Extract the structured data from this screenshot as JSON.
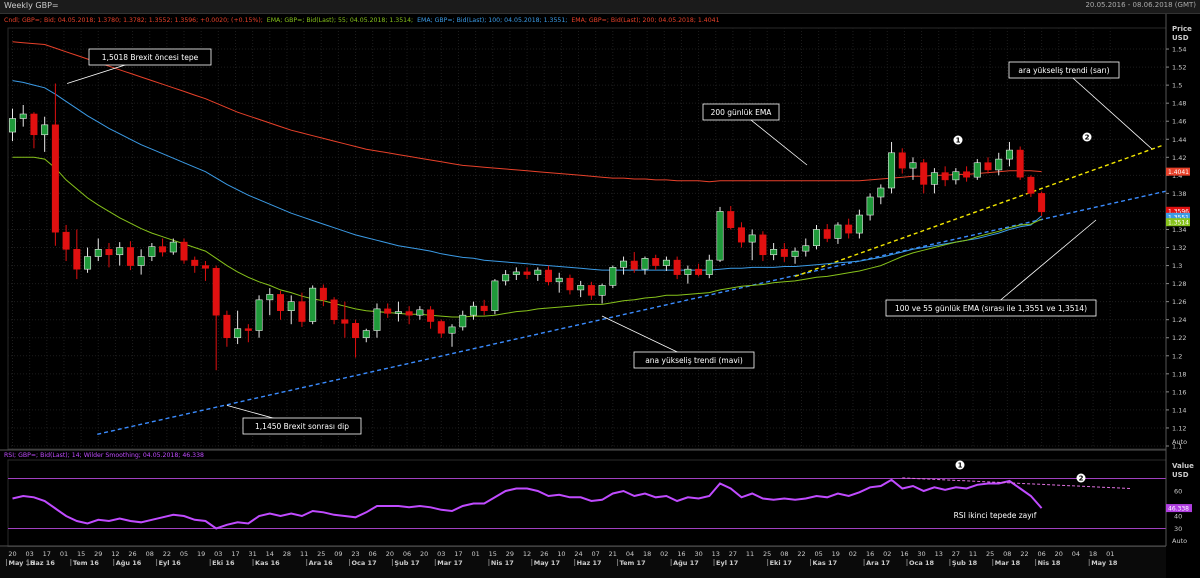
{
  "window": {
    "title": "Weekly GBP=",
    "date_range": "20.05.2016 - 08.06.2018 (GMT)"
  },
  "legend": {
    "ohlc": "Cndl; GBP=; Bid; 04.05.2018; 1.3780; 1.3782; 1.3552; 1.3596; +0.0020; (+0.15%);",
    "ema55": "EMA; GBP=; Bid(Last); 55; 04.05.2018; 1.3514;",
    "ema100": "EMA; GBP=; Bid(Last); 100; 04.05.2018; 1.3551;",
    "ema200": "EMA; GBP=; Bid(Last); 200; 04.05.2018; 1.4041",
    "rsi": "RSI; GBP=; Bid(Last); 14; Wilder Smoothing; 04.05.2018; 46.338"
  },
  "axis": {
    "price_title": "Price",
    "price_unit": "USD",
    "value_title": "Value",
    "value_unit": "USD",
    "auto_label": "Auto",
    "price_ticks": [
      "1.54",
      "1.52",
      "1.5",
      "1.48",
      "1.46",
      "1.44",
      "1.42",
      "1.4",
      "1.38",
      "1.36",
      "1.34",
      "1.32",
      "1.3",
      "1.28",
      "1.26",
      "1.24",
      "1.22",
      "1.2",
      "1.18",
      "1.16",
      "1.14",
      "1.12",
      "1.1"
    ],
    "rsi_ticks": [
      "60",
      "40",
      "30"
    ],
    "price_badges": [
      {
        "label": "1.4041",
        "value": 1.4041,
        "color": "#e8412a"
      },
      {
        "label": "1.3596",
        "value": 1.3596,
        "color": "#e01010"
      },
      {
        "label": "1.3551",
        "value": 1.3551,
        "color": "#3b9be6"
      },
      {
        "label": "1.3514",
        "value": 1.3514,
        "color": "#86c21b"
      }
    ],
    "rsi_badge": {
      "label": "46.338",
      "value": 46.338,
      "color": "#b03ee0"
    },
    "x_days": [
      "20",
      "03",
      "17",
      "01",
      "15",
      "29",
      "12",
      "26",
      "08",
      "22",
      "05",
      "19",
      "03",
      "17",
      "31",
      "14",
      "28",
      "11",
      "25",
      "09",
      "23",
      "06",
      "20",
      "06",
      "20",
      "03",
      "17",
      "01",
      "15",
      "29",
      "12",
      "26",
      "10",
      "24",
      "07",
      "21",
      "04",
      "18",
      "02",
      "16",
      "30",
      "13",
      "27",
      "11",
      "25",
      "08",
      "22",
      "05",
      "19",
      "02",
      "16",
      "02",
      "16",
      "30",
      "13",
      "27",
      "11",
      "25",
      "08",
      "22",
      "06",
      "20",
      "04",
      "18",
      "01"
    ],
    "x_months": [
      {
        "label": "May 16",
        "i": 0
      },
      {
        "label": "Haz 16",
        "i": 2
      },
      {
        "label": "Tem 16",
        "i": 6
      },
      {
        "label": "Ağu 16",
        "i": 10
      },
      {
        "label": "Eyl 16",
        "i": 14
      },
      {
        "label": "Eki 16",
        "i": 19
      },
      {
        "label": "Kas 16",
        "i": 23
      },
      {
        "label": "Ara 16",
        "i": 28
      },
      {
        "label": "Oca 17",
        "i": 32
      },
      {
        "label": "Şub 17",
        "i": 36
      },
      {
        "label": "Mar 17",
        "i": 40
      },
      {
        "label": "Nis 17",
        "i": 45
      },
      {
        "label": "May 17",
        "i": 49
      },
      {
        "label": "Haz 17",
        "i": 53
      },
      {
        "label": "Tem 17",
        "i": 57
      },
      {
        "label": "Ağu 17",
        "i": 62
      },
      {
        "label": "Eyl 17",
        "i": 66
      },
      {
        "label": "Eki 17",
        "i": 71
      },
      {
        "label": "Kas 17",
        "i": 75
      },
      {
        "label": "Ara 17",
        "i": 80
      },
      {
        "label": "Oca 18",
        "i": 84
      },
      {
        "label": "Şub 18",
        "i": 88
      },
      {
        "label": "Mar 18",
        "i": 92
      },
      {
        "label": "Nis 18",
        "i": 96
      },
      {
        "label": "May 18",
        "i": 101
      }
    ]
  },
  "annotations": {
    "brexit_top": "1,5018 Brexit öncesi tepe",
    "brexit_dip": "1,1450 Brexit sonrası dip",
    "ema200_note": "200 günlük EMA",
    "yellow_trend": "ara yükseliş trendi (sarı)",
    "blue_trend": "ana yükseliş trendi (mavi)",
    "ema_note": "100 ve 55 günlük EMA (sırası ile 1,3551 ve 1,3514)",
    "rsi_note": "RSI ikinci tepede zayıf",
    "marker_1": "1",
    "marker_2": "2"
  },
  "chart_data": {
    "type": "line",
    "subtype": "candlestick",
    "title": "Weekly GBP=",
    "x_start": "20.05.2016",
    "x_end": "08.06.2018",
    "x_interval": "weekly",
    "ylim": [
      1.1,
      1.56
    ],
    "rsi_ylim": [
      20,
      80
    ],
    "colors": {
      "up": "#1f9a3a",
      "down": "#e01010",
      "ema55": "#86c21b",
      "ema100": "#3b9be6",
      "ema200": "#e8412a",
      "rsi": "#c04bff",
      "trend_blue": "#3b8cff",
      "trend_yellow": "#f2e600"
    },
    "candles": [
      [
        1.448,
        1.474,
        1.438,
        1.463
      ],
      [
        1.463,
        1.478,
        1.454,
        1.468
      ],
      [
        1.468,
        1.47,
        1.43,
        1.445
      ],
      [
        1.445,
        1.465,
        1.426,
        1.456
      ],
      [
        1.456,
        1.5018,
        1.322,
        1.337
      ],
      [
        1.337,
        1.345,
        1.305,
        1.318
      ],
      [
        1.318,
        1.34,
        1.285,
        1.296
      ],
      [
        1.296,
        1.32,
        1.292,
        1.31
      ],
      [
        1.31,
        1.33,
        1.305,
        1.318
      ],
      [
        1.318,
        1.325,
        1.298,
        1.312
      ],
      [
        1.312,
        1.326,
        1.3,
        1.32
      ],
      [
        1.32,
        1.327,
        1.295,
        1.3
      ],
      [
        1.3,
        1.318,
        1.29,
        1.31
      ],
      [
        1.31,
        1.325,
        1.305,
        1.321
      ],
      [
        1.321,
        1.33,
        1.31,
        1.315
      ],
      [
        1.315,
        1.33,
        1.312,
        1.326
      ],
      [
        1.326,
        1.33,
        1.302,
        1.306
      ],
      [
        1.306,
        1.31,
        1.292,
        1.3
      ],
      [
        1.3,
        1.305,
        1.283,
        1.297
      ],
      [
        1.297,
        1.3,
        1.184,
        1.245
      ],
      [
        1.245,
        1.25,
        1.21,
        1.22
      ],
      [
        1.22,
        1.25,
        1.213,
        1.23
      ],
      [
        1.23,
        1.235,
        1.215,
        1.228
      ],
      [
        1.228,
        1.267,
        1.22,
        1.262
      ],
      [
        1.262,
        1.275,
        1.245,
        1.268
      ],
      [
        1.268,
        1.272,
        1.24,
        1.25
      ],
      [
        1.25,
        1.267,
        1.235,
        1.26
      ],
      [
        1.26,
        1.27,
        1.232,
        1.238
      ],
      [
        1.238,
        1.278,
        1.235,
        1.275
      ],
      [
        1.275,
        1.279,
        1.255,
        1.262
      ],
      [
        1.262,
        1.265,
        1.235,
        1.24
      ],
      [
        1.24,
        1.26,
        1.22,
        1.236
      ],
      [
        1.236,
        1.24,
        1.198,
        1.22
      ],
      [
        1.22,
        1.23,
        1.215,
        1.228
      ],
      [
        1.228,
        1.258,
        1.22,
        1.252
      ],
      [
        1.252,
        1.258,
        1.242,
        1.247
      ],
      [
        1.247,
        1.26,
        1.238,
        1.249
      ],
      [
        1.249,
        1.255,
        1.235,
        1.245
      ],
      [
        1.245,
        1.255,
        1.24,
        1.251
      ],
      [
        1.251,
        1.255,
        1.23,
        1.238
      ],
      [
        1.238,
        1.24,
        1.22,
        1.225
      ],
      [
        1.225,
        1.235,
        1.21,
        1.232
      ],
      [
        1.232,
        1.25,
        1.228,
        1.245
      ],
      [
        1.245,
        1.26,
        1.24,
        1.255
      ],
      [
        1.255,
        1.262,
        1.245,
        1.25
      ],
      [
        1.25,
        1.285,
        1.246,
        1.283
      ],
      [
        1.283,
        1.295,
        1.278,
        1.29
      ],
      [
        1.29,
        1.298,
        1.284,
        1.293
      ],
      [
        1.293,
        1.298,
        1.285,
        1.29
      ],
      [
        1.29,
        1.298,
        1.283,
        1.295
      ],
      [
        1.295,
        1.3,
        1.278,
        1.282
      ],
      [
        1.282,
        1.292,
        1.27,
        1.286
      ],
      [
        1.286,
        1.29,
        1.268,
        1.273
      ],
      [
        1.273,
        1.283,
        1.265,
        1.278
      ],
      [
        1.278,
        1.282,
        1.262,
        1.267
      ],
      [
        1.267,
        1.28,
        1.258,
        1.278
      ],
      [
        1.278,
        1.3,
        1.275,
        1.298
      ],
      [
        1.298,
        1.31,
        1.29,
        1.305
      ],
      [
        1.305,
        1.315,
        1.292,
        1.296
      ],
      [
        1.296,
        1.31,
        1.29,
        1.308
      ],
      [
        1.308,
        1.312,
        1.295,
        1.3
      ],
      [
        1.3,
        1.31,
        1.294,
        1.306
      ],
      [
        1.306,
        1.31,
        1.285,
        1.29
      ],
      [
        1.29,
        1.3,
        1.28,
        1.296
      ],
      [
        1.296,
        1.302,
        1.288,
        1.29
      ],
      [
        1.29,
        1.312,
        1.286,
        1.306
      ],
      [
        1.306,
        1.365,
        1.304,
        1.36
      ],
      [
        1.36,
        1.366,
        1.34,
        1.342
      ],
      [
        1.342,
        1.348,
        1.32,
        1.326
      ],
      [
        1.326,
        1.34,
        1.306,
        1.334
      ],
      [
        1.334,
        1.338,
        1.305,
        1.312
      ],
      [
        1.312,
        1.325,
        1.306,
        1.318
      ],
      [
        1.318,
        1.325,
        1.304,
        1.31
      ],
      [
        1.31,
        1.32,
        1.302,
        1.316
      ],
      [
        1.316,
        1.33,
        1.31,
        1.322
      ],
      [
        1.322,
        1.345,
        1.318,
        1.34
      ],
      [
        1.34,
        1.346,
        1.326,
        1.33
      ],
      [
        1.33,
        1.348,
        1.324,
        1.345
      ],
      [
        1.345,
        1.352,
        1.33,
        1.336
      ],
      [
        1.336,
        1.362,
        1.33,
        1.356
      ],
      [
        1.356,
        1.38,
        1.35,
        1.376
      ],
      [
        1.376,
        1.39,
        1.368,
        1.386
      ],
      [
        1.386,
        1.437,
        1.38,
        1.425
      ],
      [
        1.425,
        1.43,
        1.402,
        1.408
      ],
      [
        1.408,
        1.42,
        1.395,
        1.414
      ],
      [
        1.414,
        1.418,
        1.38,
        1.39
      ],
      [
        1.39,
        1.408,
        1.38,
        1.403
      ],
      [
        1.403,
        1.41,
        1.388,
        1.395
      ],
      [
        1.395,
        1.408,
        1.39,
        1.404
      ],
      [
        1.404,
        1.41,
        1.393,
        1.398
      ],
      [
        1.398,
        1.418,
        1.395,
        1.414
      ],
      [
        1.414,
        1.42,
        1.402,
        1.406
      ],
      [
        1.406,
        1.425,
        1.4,
        1.418
      ],
      [
        1.418,
        1.437,
        1.41,
        1.428
      ],
      [
        1.428,
        1.432,
        1.395,
        1.398
      ],
      [
        1.398,
        1.4,
        1.376,
        1.38
      ],
      [
        1.38,
        1.382,
        1.355,
        1.3596
      ]
    ],
    "ema55": [
      1.42,
      1.42,
      1.42,
      1.418,
      1.408,
      1.395,
      1.385,
      1.375,
      1.367,
      1.36,
      1.353,
      1.347,
      1.341,
      1.336,
      1.332,
      1.328,
      1.324,
      1.32,
      1.316,
      1.308,
      1.3,
      1.293,
      1.287,
      1.282,
      1.278,
      1.273,
      1.27,
      1.266,
      1.263,
      1.261,
      1.258,
      1.255,
      1.252,
      1.25,
      1.249,
      1.248,
      1.247,
      1.246,
      1.246,
      1.245,
      1.244,
      1.243,
      1.243,
      1.244,
      1.244,
      1.245,
      1.247,
      1.249,
      1.25,
      1.252,
      1.253,
      1.254,
      1.255,
      1.256,
      1.257,
      1.257,
      1.259,
      1.261,
      1.262,
      1.264,
      1.265,
      1.267,
      1.267,
      1.268,
      1.269,
      1.27,
      1.273,
      1.275,
      1.277,
      1.278,
      1.279,
      1.281,
      1.282,
      1.283,
      1.285,
      1.287,
      1.288,
      1.29,
      1.292,
      1.294,
      1.297,
      1.3,
      1.305,
      1.31,
      1.314,
      1.317,
      1.32,
      1.323,
      1.326,
      1.328,
      1.332,
      1.335,
      1.338,
      1.342,
      1.345,
      1.346,
      1.3514
    ],
    "ema100": [
      1.505,
      1.503,
      1.5,
      1.497,
      1.49,
      1.482,
      1.474,
      1.466,
      1.459,
      1.452,
      1.446,
      1.44,
      1.434,
      1.429,
      1.424,
      1.419,
      1.414,
      1.409,
      1.404,
      1.397,
      1.39,
      1.384,
      1.378,
      1.373,
      1.368,
      1.363,
      1.358,
      1.354,
      1.35,
      1.346,
      1.342,
      1.338,
      1.334,
      1.331,
      1.328,
      1.325,
      1.322,
      1.32,
      1.318,
      1.316,
      1.313,
      1.311,
      1.309,
      1.308,
      1.306,
      1.305,
      1.304,
      1.303,
      1.302,
      1.301,
      1.3,
      1.299,
      1.298,
      1.297,
      1.296,
      1.295,
      1.295,
      1.295,
      1.295,
      1.295,
      1.295,
      1.295,
      1.295,
      1.295,
      1.295,
      1.295,
      1.296,
      1.297,
      1.297,
      1.298,
      1.298,
      1.298,
      1.299,
      1.299,
      1.3,
      1.301,
      1.302,
      1.303,
      1.304,
      1.305,
      1.307,
      1.309,
      1.312,
      1.315,
      1.318,
      1.32,
      1.322,
      1.324,
      1.326,
      1.328,
      1.33,
      1.333,
      1.336,
      1.34,
      1.343,
      1.345,
      1.3551
    ],
    "ema200": [
      1.548,
      1.547,
      1.546,
      1.545,
      1.541,
      1.537,
      1.533,
      1.529,
      1.525,
      1.521,
      1.517,
      1.513,
      1.509,
      1.505,
      1.501,
      1.497,
      1.493,
      1.489,
      1.485,
      1.48,
      1.475,
      1.47,
      1.466,
      1.462,
      1.458,
      1.454,
      1.45,
      1.447,
      1.444,
      1.441,
      1.438,
      1.435,
      1.432,
      1.429,
      1.427,
      1.425,
      1.423,
      1.421,
      1.419,
      1.417,
      1.415,
      1.413,
      1.411,
      1.41,
      1.409,
      1.408,
      1.407,
      1.406,
      1.405,
      1.404,
      1.403,
      1.402,
      1.401,
      1.4,
      1.399,
      1.398,
      1.397,
      1.397,
      1.396,
      1.396,
      1.395,
      1.395,
      1.394,
      1.394,
      1.394,
      1.393,
      1.394,
      1.394,
      1.394,
      1.394,
      1.394,
      1.394,
      1.394,
      1.394,
      1.394,
      1.394,
      1.394,
      1.394,
      1.394,
      1.394,
      1.395,
      1.396,
      1.397,
      1.398,
      1.399,
      1.399,
      1.4,
      1.4,
      1.401,
      1.401,
      1.402,
      1.403,
      1.404,
      1.405,
      1.405,
      1.405,
      1.4041
    ],
    "rsi": [
      54,
      56,
      55,
      52,
      46,
      40,
      36,
      34,
      37,
      36,
      38,
      36,
      35,
      37,
      39,
      41,
      40,
      37,
      36,
      30,
      33,
      35,
      34,
      40,
      42,
      40,
      42,
      40,
      44,
      43,
      41,
      40,
      39,
      43,
      48,
      48,
      48,
      47,
      48,
      47,
      45,
      44,
      48,
      50,
      50,
      55,
      60,
      62,
      62,
      60,
      56,
      57,
      55,
      55,
      52,
      53,
      58,
      60,
      56,
      58,
      55,
      56,
      52,
      55,
      54,
      56,
      66,
      62,
      55,
      58,
      54,
      53,
      54,
      53,
      54,
      56,
      55,
      58,
      56,
      59,
      63,
      64,
      69,
      62,
      64,
      60,
      63,
      61,
      63,
      62,
      65,
      66,
      66,
      68,
      62,
      56,
      46.338
    ]
  }
}
